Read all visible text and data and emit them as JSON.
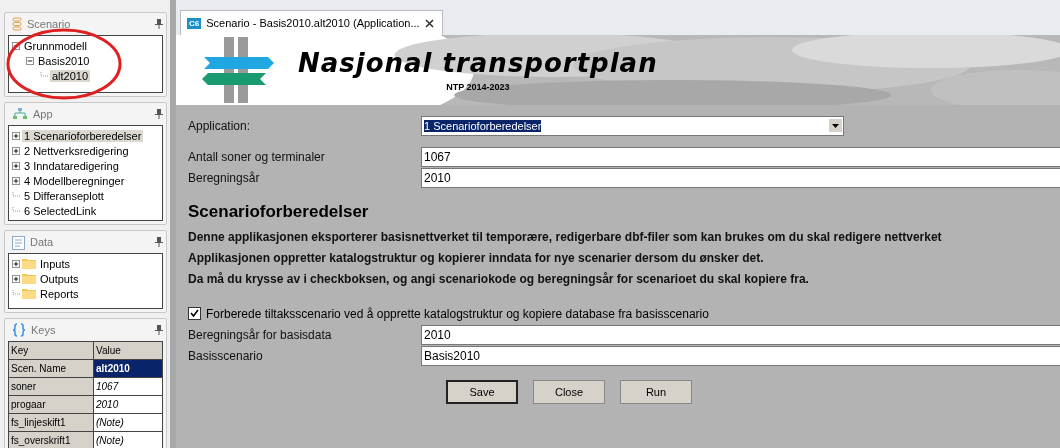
{
  "scenario_panel": {
    "title": "Scenario",
    "tree": [
      {
        "label": "Grunnmodell",
        "expanded": true,
        "selected": false,
        "children": [
          {
            "label": "Basis2010",
            "expanded": true,
            "selected": false,
            "children": [
              {
                "label": "alt2010",
                "selected": true
              }
            ]
          }
        ]
      }
    ]
  },
  "app_panel": {
    "title": "App",
    "tree": [
      {
        "label": "1 Scenarioforberedelser",
        "expanded": false,
        "selected": true
      },
      {
        "label": "2 Nettverksredigering",
        "expanded": false,
        "selected": false
      },
      {
        "label": "3 Inndataredigering",
        "expanded": false,
        "selected": false
      },
      {
        "label": "4 Modellberegninger",
        "expanded": false,
        "selected": false
      },
      {
        "label": "5 Differanseplott",
        "selected": false
      },
      {
        "label": "6 SelectedLink",
        "selected": false
      }
    ]
  },
  "data_panel": {
    "title": "Data",
    "tree": [
      {
        "label": "Inputs",
        "expanded": false,
        "selected": false
      },
      {
        "label": "Outputs",
        "expanded": false,
        "selected": false
      },
      {
        "label": "Reports",
        "selected": false
      }
    ]
  },
  "keys_panel": {
    "title": "Keys",
    "columns": [
      "Key",
      "Value"
    ],
    "rows": [
      {
        "key": "Scen. Name",
        "value": "alt2010",
        "selected": true
      },
      {
        "key": "soner",
        "value": "1067",
        "selected": false
      },
      {
        "key": "progaar",
        "value": "2010",
        "selected": false
      },
      {
        "key": "fs_linjeskift1",
        "value": "(Note)",
        "selected": false
      },
      {
        "key": "fs_overskrift1",
        "value": "(Note)",
        "selected": false
      }
    ]
  },
  "tab": {
    "badge": "C6",
    "label": "Scenario - Basis2010.alt2010 (Application...",
    "selected": true
  },
  "banner": {
    "title": "Nasjonal transportplan",
    "subtitle": "NTP 2014-2023"
  },
  "form": {
    "application_label": "Application:",
    "application_value": "1 Scenarioforberedelser",
    "fields": [
      {
        "label": "Antall soner og terminaler",
        "value": "1067"
      },
      {
        "label": "Beregningsår",
        "value": "2010"
      }
    ],
    "heading": "Scenarioforberedelser",
    "paragraphs": [
      "Denne applikasjonen eksporterer basisnettverket til temporære, redigerbare dbf-filer som kan brukes om du skal redigere nettverket",
      "Applikasjonen oppretter katalogstruktur og kopierer inndata for nye scenarier dersom du ønsker det.",
      "Da må du krysse av i checkboksen, og angi scenariokode og beregningsår for scenarioet du skal kopiere fra."
    ],
    "checkbox": {
      "label": "Forberede tiltaksscenario ved å opprette katalogstruktur og kopiere database fra basisscenario",
      "checked": true
    },
    "fields2": [
      {
        "label": "Beregningsår for basisdata",
        "value": "2010"
      },
      {
        "label": "Basisscenario",
        "value": "Basis2010"
      }
    ],
    "buttons": [
      {
        "label": "Save",
        "default": true
      },
      {
        "label": "Close",
        "default": false
      },
      {
        "label": "Run",
        "default": false
      }
    ]
  }
}
